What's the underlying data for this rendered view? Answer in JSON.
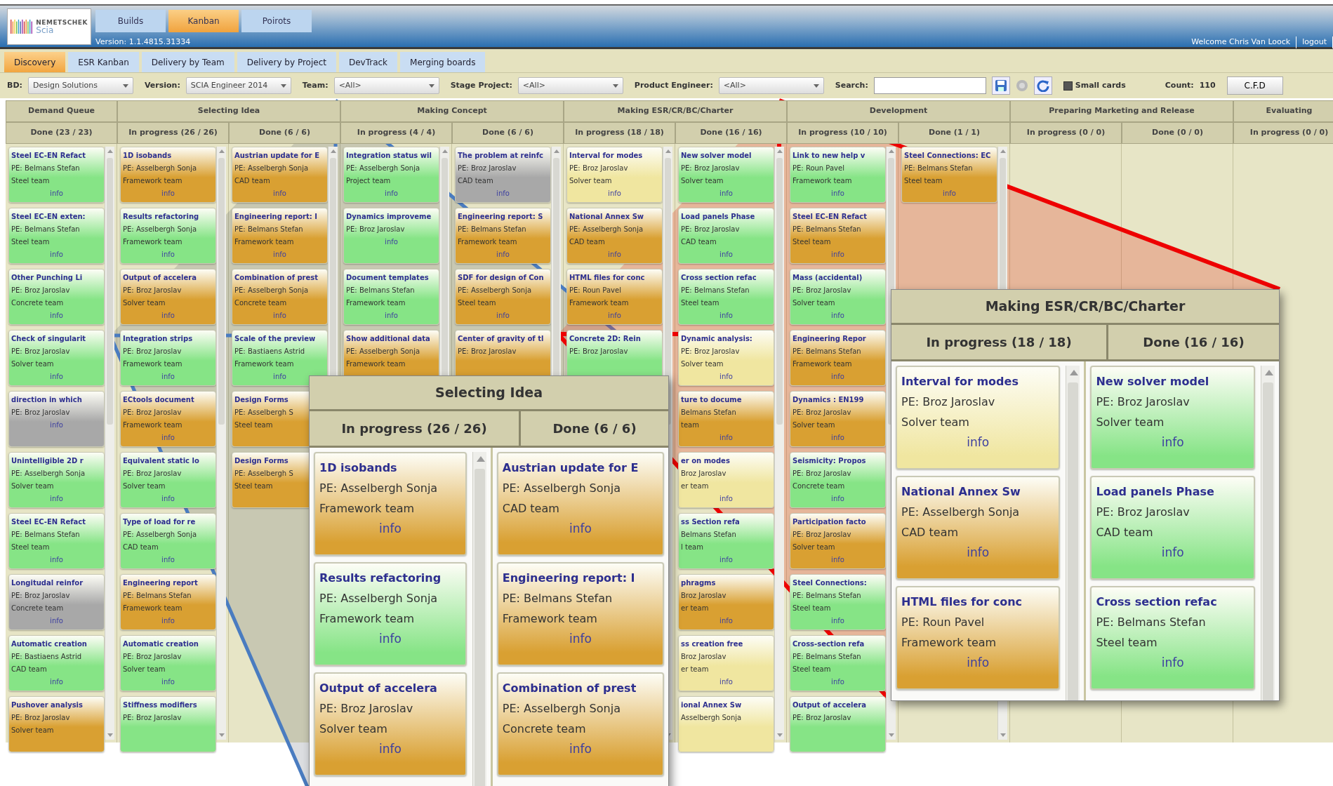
{
  "header": {
    "logo_name": "NEMETSCHEK",
    "logo_sub": "Scia",
    "tabs": [
      {
        "label": "Builds",
        "selected": false
      },
      {
        "label": "Kanban",
        "selected": true
      },
      {
        "label": "Poirots",
        "selected": false
      }
    ],
    "version": "Version: 1.1.4815.31334",
    "welcome": "Welcome Chris Van Loock",
    "logout": "logout"
  },
  "subnav": [
    {
      "label": "Discovery",
      "selected": true
    },
    {
      "label": "ESR Kanban",
      "selected": false
    },
    {
      "label": "Delivery by Team",
      "selected": false
    },
    {
      "label": "Delivery by Project",
      "selected": false
    },
    {
      "label": "DevTrack",
      "selected": false
    },
    {
      "label": "Merging boards",
      "selected": false
    }
  ],
  "filters": [
    {
      "kind": "select",
      "label": "BD:",
      "value": "Design Solutions"
    },
    {
      "kind": "select",
      "label": "Version:",
      "value": "SCIA Engineer 2014"
    },
    {
      "kind": "select",
      "label": "Team:",
      "value": "<All>"
    },
    {
      "kind": "select",
      "label": "Stage Project:",
      "value": "<All>"
    },
    {
      "kind": "select",
      "label": "Product Engineer:",
      "value": "<All>"
    },
    {
      "kind": "search",
      "label": "Search:"
    },
    {
      "kind": "checkbox",
      "label": "Small cards",
      "checked": true
    },
    {
      "kind": "count",
      "label": "Count:",
      "value": "110"
    },
    {
      "kind": "button",
      "label": "C.F.D"
    }
  ],
  "board": {
    "stages": [
      {
        "name": "Demand Queue",
        "columns": [
          {
            "label": "Done (23 / 23)",
            "cards": [
              {
                "title": "Steel EC-EN Refact",
                "pe": "PE: Belmans Stefan",
                "team": "Steel team",
                "link": "info",
                "color": "#86e486"
              },
              {
                "title": "Steel EC-EN exten:",
                "pe": "PE: Belmans Stefan",
                "team": "Steel team",
                "link": "info",
                "color": "#86e486"
              },
              {
                "title": "Other Punching Li",
                "pe": "PE: Broz Jaroslav",
                "team": "Concrete team",
                "link": "info",
                "color": "#86e486"
              },
              {
                "title": "Check of singularit",
                "pe": "PE: Broz Jaroslav",
                "team": "Solver team",
                "link": "info",
                "color": "#86e486"
              },
              {
                "title": "direction in which",
                "pe": "PE: Broz Jaroslav",
                "link": "info",
                "color": "#a8a8a8"
              },
              {
                "title": "Unintelligible 2D r",
                "pe": "PE: Asselbergh Sonja",
                "team": "Solver team",
                "link": "info",
                "color": "#86e486"
              },
              {
                "title": "Steel EC-EN Refact",
                "pe": "PE: Belmans Stefan",
                "team": "Steel team",
                "link": "info",
                "color": "#86e486"
              },
              {
                "title": "Longitudal reinfor",
                "pe": "PE: Broz Jaroslav",
                "team": "Concrete team",
                "link": "info",
                "color": "#a8a8a8"
              },
              {
                "title": "Automatic creation",
                "pe": "PE: Bastiaens Astrid",
                "team": "CAD team",
                "link": "info",
                "color": "#86e486"
              },
              {
                "title": "Pushover analysis",
                "pe": "PE: Broz Jaroslav",
                "team": "Solver team",
                "color": "#d9a032"
              }
            ]
          }
        ]
      },
      {
        "name": "Selecting Idea",
        "columns": [
          {
            "label": "In progress (26 / 26)",
            "cards": [
              {
                "title": "1D isobands",
                "pe": "PE: Asselbergh Sonja",
                "team": "Framework team",
                "link": "info",
                "color": "#d9a032"
              },
              {
                "title": "Results refactoring",
                "pe": "PE: Asselbergh Sonja",
                "team": "Framework team",
                "link": "info",
                "color": "#86e486"
              },
              {
                "title": "Output of accelera",
                "pe": "PE: Broz Jaroslav",
                "team": "Solver team",
                "link": "info",
                "color": "#d9a032"
              },
              {
                "title": "Integration strips",
                "pe": "PE: Broz Jaroslav",
                "team": "Framework team",
                "link": "info",
                "color": "#86e486"
              },
              {
                "title": "ECtools document",
                "pe": "PE: Broz Jaroslav",
                "team": "Framework team",
                "link": "info",
                "color": "#d9a032"
              },
              {
                "title": "Equivalent static lo",
                "pe": "PE: Broz Jaroslav",
                "team": "Solver team",
                "link": "info",
                "color": "#86e486"
              },
              {
                "title": "Type of load for re",
                "pe": "PE: Asselbergh Sonja",
                "team": "CAD team",
                "link": "info",
                "color": "#86e486"
              },
              {
                "title": "Engineering report",
                "pe": "PE: Belmans Stefan",
                "team": "Framework team",
                "link": "info",
                "color": "#d9a032"
              },
              {
                "title": "Automatic creation",
                "pe": "PE: Broz Jaroslav",
                "team": "Solver team",
                "link": "info",
                "color": "#86e486"
              },
              {
                "title": "Stiffness modifiers",
                "pe": "PE: Broz Jaroslav",
                "color": "#86e486"
              }
            ]
          },
          {
            "label": "Done (6 / 6)",
            "cards": [
              {
                "title": "Austrian update for E",
                "pe": "PE: Asselbergh Sonja",
                "team": "CAD team",
                "link": "info",
                "color": "#d9a032"
              },
              {
                "title": "Engineering report: I",
                "pe": "PE: Belmans Stefan",
                "team": "Framework team",
                "link": "info",
                "color": "#d9a032"
              },
              {
                "title": "Combination of prest",
                "pe": "PE: Asselbergh Sonja",
                "team": "Concrete team",
                "link": "info",
                "color": "#d9a032"
              },
              {
                "title": "Scale of the preview",
                "pe": "PE: Bastiaens Astrid",
                "team": "Framework team",
                "link": "info",
                "color": "#86e486"
              },
              {
                "title": "Design Forms",
                "pe": "PE: Asselbergh S",
                "team": "Steel team",
                "color": "#d9a032"
              },
              {
                "title": "Design Forms",
                "pe": "PE: Asselbergh S",
                "team": "Steel team",
                "color": "#d9a032"
              }
            ]
          }
        ]
      },
      {
        "name": "Making Concept",
        "columns": [
          {
            "label": "In progress (4 / 4)",
            "cards": [
              {
                "title": "Integration status wil",
                "pe": "PE: Asselbergh Sonja",
                "team": "Project team",
                "link": "info",
                "color": "#86e486"
              },
              {
                "title": "Dynamics improveme",
                "pe": "PE: Broz Jaroslav",
                "link": "info",
                "color": "#86e486"
              },
              {
                "title": "Document templates",
                "pe": "PE: Belmans Stefan",
                "team": "Framework team",
                "link": "info",
                "color": "#86e486"
              },
              {
                "title": "Show additional data",
                "pe": "PE: Asselbergh Sonja",
                "team": "Framework team",
                "color": "#d9a032"
              }
            ]
          },
          {
            "label": "Done (6 / 6)",
            "cards": [
              {
                "title": "The problem at reinfc",
                "pe": "PE: Broz Jaroslav",
                "team": "CAD team",
                "link": "info",
                "color": "#a8a8a8"
              },
              {
                "title": "Engineering report: S",
                "pe": "PE: Belmans Stefan",
                "team": "Framework team",
                "link": "info",
                "color": "#d9a032"
              },
              {
                "title": "SDF for design of Con",
                "pe": "PE: Asselbergh Sonja",
                "team": "Steel team",
                "link": "info",
                "color": "#d9a032"
              },
              {
                "title": "Center of gravity of tl",
                "pe": "PE: Broz Jaroslav",
                "color": "#d9a032"
              }
            ]
          }
        ]
      },
      {
        "name": "Making ESR/CR/BC/Charter",
        "columns": [
          {
            "label": "In progress (18 / 18)",
            "cards": [
              {
                "title": "Interval for modes",
                "pe": "PE: Broz Jaroslav",
                "team": "Solver team",
                "link": "info",
                "color": "#f0e6a0"
              },
              {
                "title": "National Annex Sw",
                "pe": "PE: Asselbergh Sonja",
                "team": "CAD team",
                "link": "info",
                "color": "#d9a032"
              },
              {
                "title": "HTML files for conc",
                "pe": "PE: Roun Pavel",
                "team": "Framework team",
                "link": "info",
                "color": "#d9a032"
              },
              {
                "title": "Concrete 2D: Rein",
                "pe": "PE: Broz Jaroslav",
                "color": "#86e486"
              }
            ]
          },
          {
            "label": "Done (16 / 16)",
            "cards": [
              {
                "title": "New solver model",
                "pe": "PE: Broz Jaroslav",
                "team": "Solver team",
                "link": "info",
                "color": "#86e486"
              },
              {
                "title": "Load panels Phase",
                "pe": "PE: Broz Jaroslav",
                "team": "CAD team",
                "link": "info",
                "color": "#86e486"
              },
              {
                "title": "Cross section refac",
                "pe": "PE: Belmans Stefan",
                "team": "Steel team",
                "link": "info",
                "color": "#86e486"
              },
              {
                "title": "Dynamic analysis:",
                "pe": "PE: Broz Jaroslav",
                "team": "Solver team",
                "link": "info",
                "color": "#f0e6a0"
              },
              {
                "title": "ture to docume",
                "pe": "Belmans Stefan",
                "team": "team",
                "link": "info",
                "color": "#d9a032"
              },
              {
                "title": "er on modes",
                "pe": "Broz Jaroslav",
                "team": "er team",
                "link": "info",
                "color": "#f0e6a0"
              },
              {
                "title": "ss Section refa",
                "pe": "Belmans Stefan",
                "team": "l team",
                "link": "info",
                "color": "#86e486"
              },
              {
                "title": "phragms",
                "pe": "Broz Jaroslav",
                "team": "er team",
                "link": "info",
                "color": "#d9a032"
              },
              {
                "title": "ss creation free",
                "pe": "Broz Jaroslav",
                "team": "er team",
                "link": "info",
                "color": "#f0e6a0"
              },
              {
                "title": "ional Annex Sw",
                "pe": "Asselbergh Sonja",
                "color": "#f0e6a0"
              }
            ]
          }
        ]
      },
      {
        "name": "Development",
        "columns": [
          {
            "label": "In progress (10 / 10)",
            "cards": [
              {
                "title": "Link to new help v",
                "pe": "PE: Roun Pavel",
                "team": "Framework team",
                "link": "info",
                "color": "#86e486"
              },
              {
                "title": "Steel EC-EN Refact",
                "pe": "PE: Belmans Stefan",
                "team": "Steel team",
                "link": "info",
                "color": "#d9a032"
              },
              {
                "title": "Mass (accidental)",
                "pe": "PE: Broz Jaroslav",
                "team": "Solver team",
                "link": "info",
                "color": "#86e486"
              },
              {
                "title": "Engineering Repor",
                "pe": "PE: Belmans Stefan",
                "team": "Framework team",
                "link": "info",
                "color": "#d9a032"
              },
              {
                "title": "Dynamics : EN199",
                "pe": "PE: Broz Jaroslav",
                "team": "Solver team",
                "link": "info",
                "color": "#d9a032"
              },
              {
                "title": "Seismicity: Propos",
                "pe": "PE: Broz Jaroslav",
                "team": "Concrete team",
                "link": "info",
                "color": "#86e486"
              },
              {
                "title": "Participation facto",
                "pe": "PE: Broz Jaroslav",
                "team": "Solver team",
                "link": "info",
                "color": "#d9a032"
              },
              {
                "title": "Steel Connections:",
                "pe": "PE: Belmans Stefan",
                "team": "Steel team",
                "link": "info",
                "color": "#86e486"
              },
              {
                "title": "Cross-section refa",
                "pe": "PE: Belmans Stefan",
                "team": "Steel team",
                "link": "info",
                "color": "#86e486"
              },
              {
                "title": "Output of accelera",
                "pe": "PE: Broz Jaroslav",
                "color": "#86e486"
              }
            ]
          },
          {
            "label": "Done (1 / 1)",
            "cards": [
              {
                "title": "Steel Connections: EC",
                "pe": "PE: Belmans Stefan",
                "team": "Steel team",
                "link": "info",
                "color": "#d9a032"
              }
            ]
          }
        ]
      },
      {
        "name": "Preparing Marketing and Release",
        "columns": [
          {
            "label": "In progress (0 / 0)"
          },
          {
            "label": "Done (0 / 0)"
          }
        ]
      },
      {
        "name": "Evaluating",
        "columns": [
          {
            "label": "In progress (0 / 0)"
          }
        ]
      }
    ]
  },
  "insets": [
    {
      "name": "Selecting Idea",
      "columns": [
        {
          "label": "In progress (26 / 26)",
          "cards": [
            {
              "title": "1D isobands",
              "pe": "PE: Asselbergh Sonja",
              "team": "Framework team",
              "link": "info",
              "color": "#d9a032"
            },
            {
              "title": "Results refactoring",
              "pe": "PE: Asselbergh Sonja",
              "team": "Framework team",
              "link": "info",
              "color": "#86e486"
            },
            {
              "title": "Output of accelera",
              "pe": "PE: Broz Jaroslav",
              "team": "Solver team",
              "link": "info",
              "color": "#d9a032"
            }
          ]
        },
        {
          "label": "Done (6 / 6)",
          "cards": [
            {
              "title": "Austrian update for E",
              "pe": "PE: Asselbergh Sonja",
              "team": "CAD team",
              "link": "info",
              "color": "#d9a032"
            },
            {
              "title": "Engineering report: I",
              "pe": "PE: Belmans Stefan",
              "team": "Framework team",
              "link": "info",
              "color": "#d9a032"
            },
            {
              "title": "Combination of prest",
              "pe": "PE: Asselbergh Sonja",
              "team": "Concrete team",
              "link": "info",
              "color": "#d9a032"
            }
          ]
        }
      ]
    },
    {
      "name": "Making ESR/CR/BC/Charter",
      "columns": [
        {
          "label": "In progress (18 / 18)",
          "cards": [
            {
              "title": "Interval for modes",
              "pe": "PE: Broz Jaroslav",
              "team": "Solver team",
              "link": "info",
              "color": "#f0e6a0"
            },
            {
              "title": "National Annex Sw",
              "pe": "PE: Asselbergh Sonja",
              "team": "CAD team",
              "link": "info",
              "color": "#d9a032"
            },
            {
              "title": "HTML files for conc",
              "pe": "PE: Roun Pavel",
              "team": "Framework team",
              "link": "info",
              "color": "#d9a032"
            }
          ]
        },
        {
          "label": "Done (16 / 16)",
          "cards": [
            {
              "title": "New solver model",
              "pe": "PE: Broz Jaroslav",
              "team": "Solver team",
              "link": "info",
              "color": "#86e486"
            },
            {
              "title": "Load panels Phase",
              "pe": "PE: Broz Jaroslav",
              "team": "CAD team",
              "link": "info",
              "color": "#86e486"
            },
            {
              "title": "Cross section refac",
              "pe": "PE: Belmans Stefan",
              "team": "Steel team",
              "link": "info",
              "color": "#86e486"
            }
          ]
        }
      ]
    }
  ]
}
